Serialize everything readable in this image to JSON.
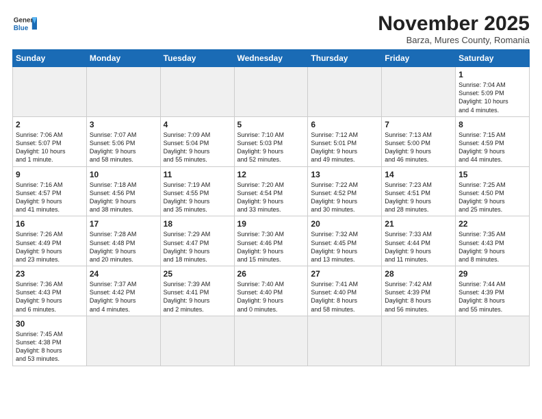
{
  "logo": {
    "general": "General",
    "blue": "Blue"
  },
  "title": "November 2025",
  "subtitle": "Barza, Mures County, Romania",
  "weekdays": [
    "Sunday",
    "Monday",
    "Tuesday",
    "Wednesday",
    "Thursday",
    "Friday",
    "Saturday"
  ],
  "weeks": [
    [
      {
        "day": "",
        "info": ""
      },
      {
        "day": "",
        "info": ""
      },
      {
        "day": "",
        "info": ""
      },
      {
        "day": "",
        "info": ""
      },
      {
        "day": "",
        "info": ""
      },
      {
        "day": "",
        "info": ""
      },
      {
        "day": "1",
        "info": "Sunrise: 7:04 AM\nSunset: 5:09 PM\nDaylight: 10 hours\nand 4 minutes."
      }
    ],
    [
      {
        "day": "2",
        "info": "Sunrise: 7:06 AM\nSunset: 5:07 PM\nDaylight: 10 hours\nand 1 minute."
      },
      {
        "day": "3",
        "info": "Sunrise: 7:07 AM\nSunset: 5:06 PM\nDaylight: 9 hours\nand 58 minutes."
      },
      {
        "day": "4",
        "info": "Sunrise: 7:09 AM\nSunset: 5:04 PM\nDaylight: 9 hours\nand 55 minutes."
      },
      {
        "day": "5",
        "info": "Sunrise: 7:10 AM\nSunset: 5:03 PM\nDaylight: 9 hours\nand 52 minutes."
      },
      {
        "day": "6",
        "info": "Sunrise: 7:12 AM\nSunset: 5:01 PM\nDaylight: 9 hours\nand 49 minutes."
      },
      {
        "day": "7",
        "info": "Sunrise: 7:13 AM\nSunset: 5:00 PM\nDaylight: 9 hours\nand 46 minutes."
      },
      {
        "day": "8",
        "info": "Sunrise: 7:15 AM\nSunset: 4:59 PM\nDaylight: 9 hours\nand 44 minutes."
      }
    ],
    [
      {
        "day": "9",
        "info": "Sunrise: 7:16 AM\nSunset: 4:57 PM\nDaylight: 9 hours\nand 41 minutes."
      },
      {
        "day": "10",
        "info": "Sunrise: 7:18 AM\nSunset: 4:56 PM\nDaylight: 9 hours\nand 38 minutes."
      },
      {
        "day": "11",
        "info": "Sunrise: 7:19 AM\nSunset: 4:55 PM\nDaylight: 9 hours\nand 35 minutes."
      },
      {
        "day": "12",
        "info": "Sunrise: 7:20 AM\nSunset: 4:54 PM\nDaylight: 9 hours\nand 33 minutes."
      },
      {
        "day": "13",
        "info": "Sunrise: 7:22 AM\nSunset: 4:52 PM\nDaylight: 9 hours\nand 30 minutes."
      },
      {
        "day": "14",
        "info": "Sunrise: 7:23 AM\nSunset: 4:51 PM\nDaylight: 9 hours\nand 28 minutes."
      },
      {
        "day": "15",
        "info": "Sunrise: 7:25 AM\nSunset: 4:50 PM\nDaylight: 9 hours\nand 25 minutes."
      }
    ],
    [
      {
        "day": "16",
        "info": "Sunrise: 7:26 AM\nSunset: 4:49 PM\nDaylight: 9 hours\nand 23 minutes."
      },
      {
        "day": "17",
        "info": "Sunrise: 7:28 AM\nSunset: 4:48 PM\nDaylight: 9 hours\nand 20 minutes."
      },
      {
        "day": "18",
        "info": "Sunrise: 7:29 AM\nSunset: 4:47 PM\nDaylight: 9 hours\nand 18 minutes."
      },
      {
        "day": "19",
        "info": "Sunrise: 7:30 AM\nSunset: 4:46 PM\nDaylight: 9 hours\nand 15 minutes."
      },
      {
        "day": "20",
        "info": "Sunrise: 7:32 AM\nSunset: 4:45 PM\nDaylight: 9 hours\nand 13 minutes."
      },
      {
        "day": "21",
        "info": "Sunrise: 7:33 AM\nSunset: 4:44 PM\nDaylight: 9 hours\nand 11 minutes."
      },
      {
        "day": "22",
        "info": "Sunrise: 7:35 AM\nSunset: 4:43 PM\nDaylight: 9 hours\nand 8 minutes."
      }
    ],
    [
      {
        "day": "23",
        "info": "Sunrise: 7:36 AM\nSunset: 4:43 PM\nDaylight: 9 hours\nand 6 minutes."
      },
      {
        "day": "24",
        "info": "Sunrise: 7:37 AM\nSunset: 4:42 PM\nDaylight: 9 hours\nand 4 minutes."
      },
      {
        "day": "25",
        "info": "Sunrise: 7:39 AM\nSunset: 4:41 PM\nDaylight: 9 hours\nand 2 minutes."
      },
      {
        "day": "26",
        "info": "Sunrise: 7:40 AM\nSunset: 4:40 PM\nDaylight: 9 hours\nand 0 minutes."
      },
      {
        "day": "27",
        "info": "Sunrise: 7:41 AM\nSunset: 4:40 PM\nDaylight: 8 hours\nand 58 minutes."
      },
      {
        "day": "28",
        "info": "Sunrise: 7:42 AM\nSunset: 4:39 PM\nDaylight: 8 hours\nand 56 minutes."
      },
      {
        "day": "29",
        "info": "Sunrise: 7:44 AM\nSunset: 4:39 PM\nDaylight: 8 hours\nand 55 minutes."
      }
    ],
    [
      {
        "day": "30",
        "info": "Sunrise: 7:45 AM\nSunset: 4:38 PM\nDaylight: 8 hours\nand 53 minutes."
      },
      {
        "day": "",
        "info": ""
      },
      {
        "day": "",
        "info": ""
      },
      {
        "day": "",
        "info": ""
      },
      {
        "day": "",
        "info": ""
      },
      {
        "day": "",
        "info": ""
      },
      {
        "day": "",
        "info": ""
      }
    ]
  ]
}
